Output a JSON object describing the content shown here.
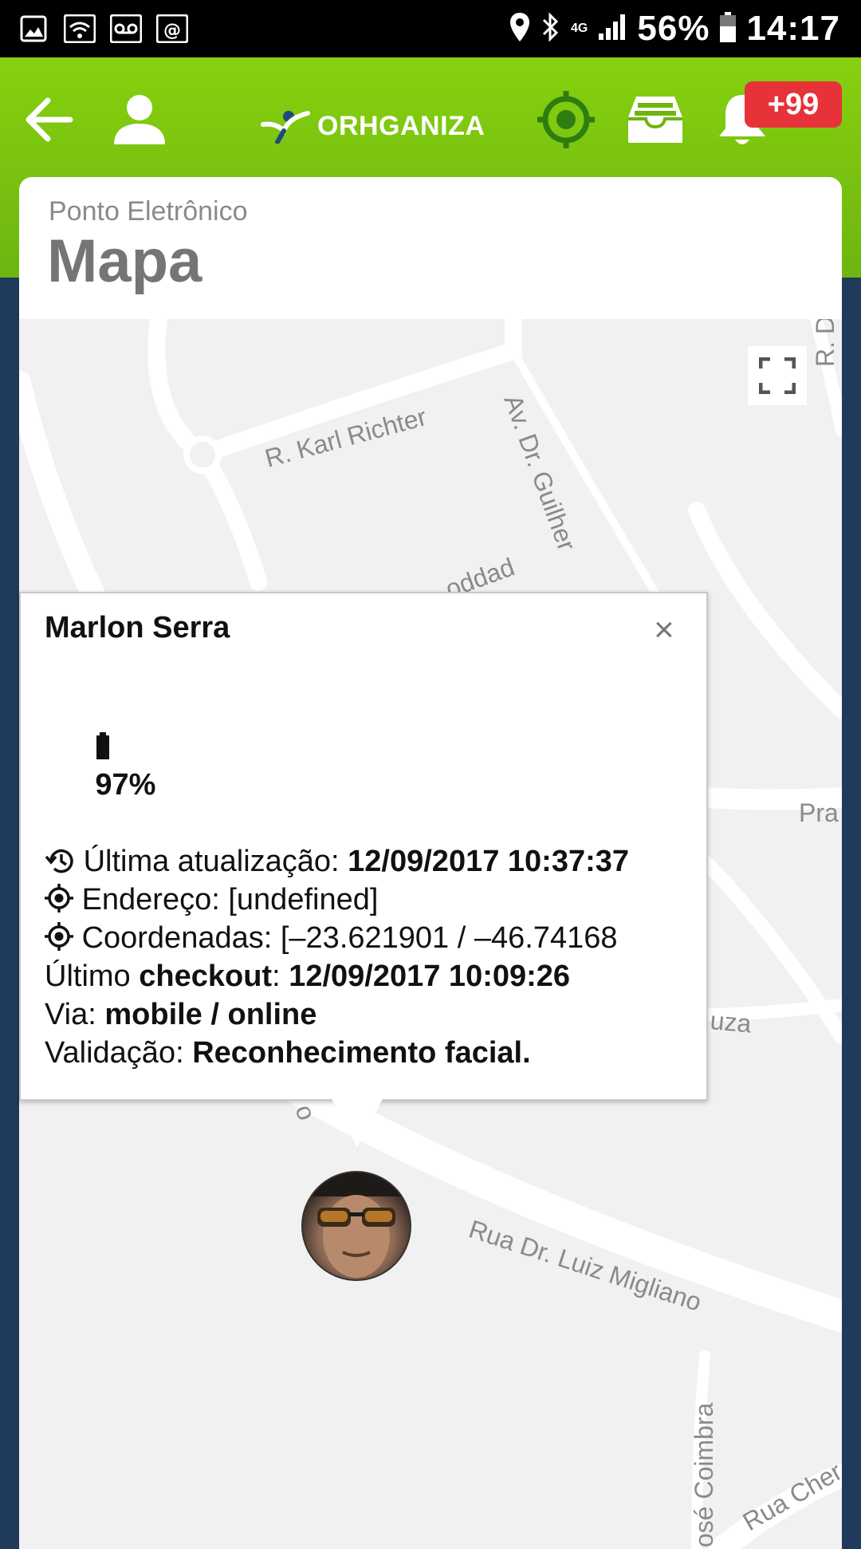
{
  "statusbar": {
    "battery_percent": "56%",
    "time": "14:17",
    "network": "4G"
  },
  "header": {
    "logo_text": "ORHGANIZA",
    "notification_badge": "+99"
  },
  "page": {
    "subtitle": "Ponto Eletrônico",
    "title": "Mapa"
  },
  "map": {
    "streets": {
      "karl_richter": "R. Karl Richter",
      "guilherme": "Av. Dr. Guilher",
      "soledad": "oddad",
      "pra": "Pra",
      "uza": "uza",
      "luiz_migliano": "Rua Dr. Luiz Migliano",
      "coimbra": "osé Coimbra",
      "rua_cher": "Rua Cher",
      "r_d": "R. D",
      "o": "o"
    }
  },
  "info_window": {
    "name": "Marlon Serra",
    "close_symbol": "×",
    "battery": "97%",
    "last_update_label": "Última atualização: ",
    "last_update_value": "12/09/2017 10:37:37",
    "address_label": "Endereço: ",
    "address_value": "[undefined]",
    "coords_label": "Coordenadas: ",
    "coords_value": "[–23.621901 / –46.74168",
    "checkout_prefix": "Último ",
    "checkout_word": "checkout",
    "checkout_sep": ": ",
    "checkout_value": "12/09/2017 10:09:26",
    "via_label": "Via: ",
    "via_value": "mobile / online",
    "validation_label": "Validação: ",
    "validation_value": "Reconhecimento facial."
  },
  "colors": {
    "header_green": "#86d10f",
    "badge_red": "#e8323a",
    "background_navy": "#1f3a5a",
    "target_icon_green": "#2e7d10"
  }
}
